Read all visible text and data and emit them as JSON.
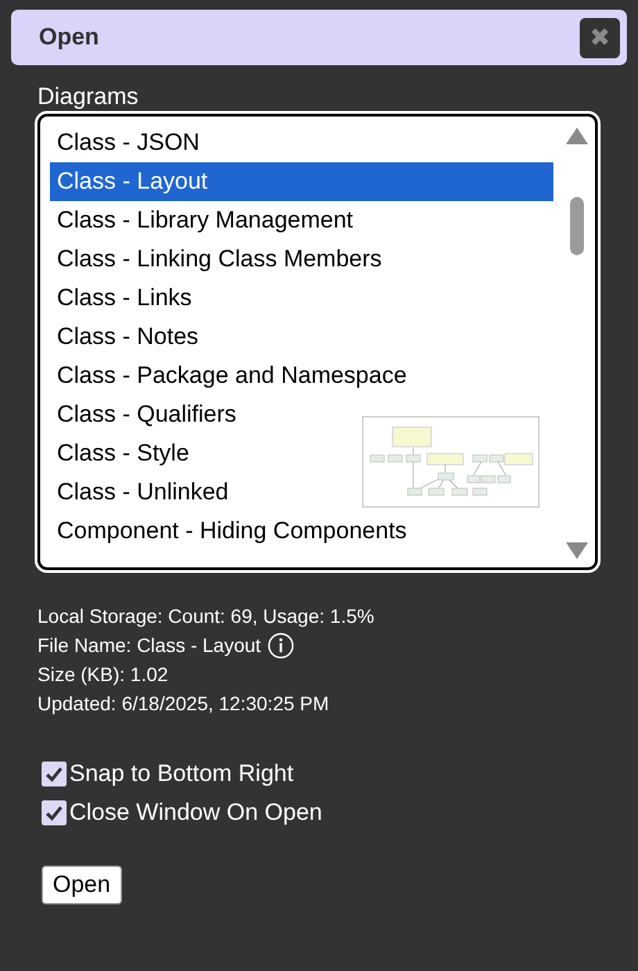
{
  "window": {
    "title": "Open",
    "close": "✖"
  },
  "diagrams": {
    "label": "Diagrams",
    "items": [
      {
        "label": "Class - JSON",
        "selected": false
      },
      {
        "label": "Class - Layout",
        "selected": true
      },
      {
        "label": "Class - Library Management",
        "selected": false
      },
      {
        "label": "Class - Linking Class Members",
        "selected": false
      },
      {
        "label": "Class - Links",
        "selected": false
      },
      {
        "label": "Class - Notes",
        "selected": false
      },
      {
        "label": "Class - Package and Namespace",
        "selected": false
      },
      {
        "label": "Class - Qualifiers",
        "selected": false
      },
      {
        "label": "Class - Style",
        "selected": false
      },
      {
        "label": "Class - Unlinked",
        "selected": false
      },
      {
        "label": "Component - Hiding Components",
        "selected": false
      }
    ]
  },
  "info": [
    {
      "text": "Local Storage: Count: 69, Usage: 1.5%",
      "info_icon": false
    },
    {
      "text": "File Name: Class - Layout",
      "info_icon": true
    },
    {
      "text": "Size (KB): 1.02",
      "info_icon": false
    },
    {
      "text": "Updated: 6/18/2025, 12:30:25 PM",
      "info_icon": false
    }
  ],
  "options": [
    {
      "label": "Snap to Bottom Right",
      "checked": true
    },
    {
      "label": "Close Window On Open",
      "checked": true
    }
  ],
  "button": "Open"
}
